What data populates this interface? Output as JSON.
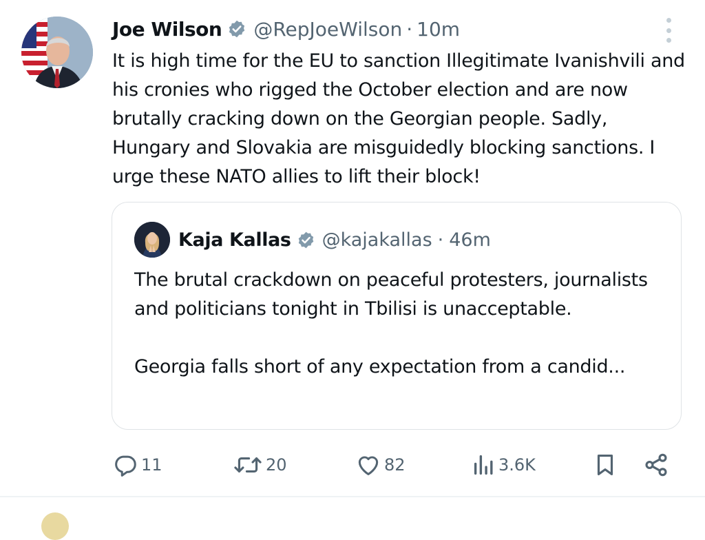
{
  "tweet": {
    "author_name": "Joe Wilson",
    "handle": "@RepJoeWilson",
    "separator": "·",
    "time": "10m",
    "text": "It is high time for the EU to sanction Illegitimate Ivanishvili and his cronies who rigged the October election and are now brutally cracking down on the Georgian people. Sadly, Hungary and Slovakia are misguidedly blocking sanctions. I urge these NATO allies to lift their block!",
    "verified_icon": "verified-badge-icon",
    "more_icon": "more-vertical-icon"
  },
  "quote": {
    "author_name": "Kaja Kallas",
    "handle": "@kajakallas",
    "separator": "·",
    "time": "46m",
    "paragraph_1": "The brutal crackdown on peaceful protesters, journalists and politicians tonight in Tbilisi is unacceptable.",
    "paragraph_2": "Georgia falls short of any expectation from a candid..."
  },
  "actions": {
    "replies": "11",
    "reposts": "20",
    "likes": "82",
    "views": "3.6K",
    "icons": [
      "reply-icon",
      "repost-icon",
      "like-icon",
      "views-icon",
      "bookmark-icon",
      "share-icon"
    ]
  },
  "colors": {
    "text": "#0f1419",
    "secondary": "#536471",
    "border": "#dfe3e6",
    "verified": "#829aab"
  }
}
